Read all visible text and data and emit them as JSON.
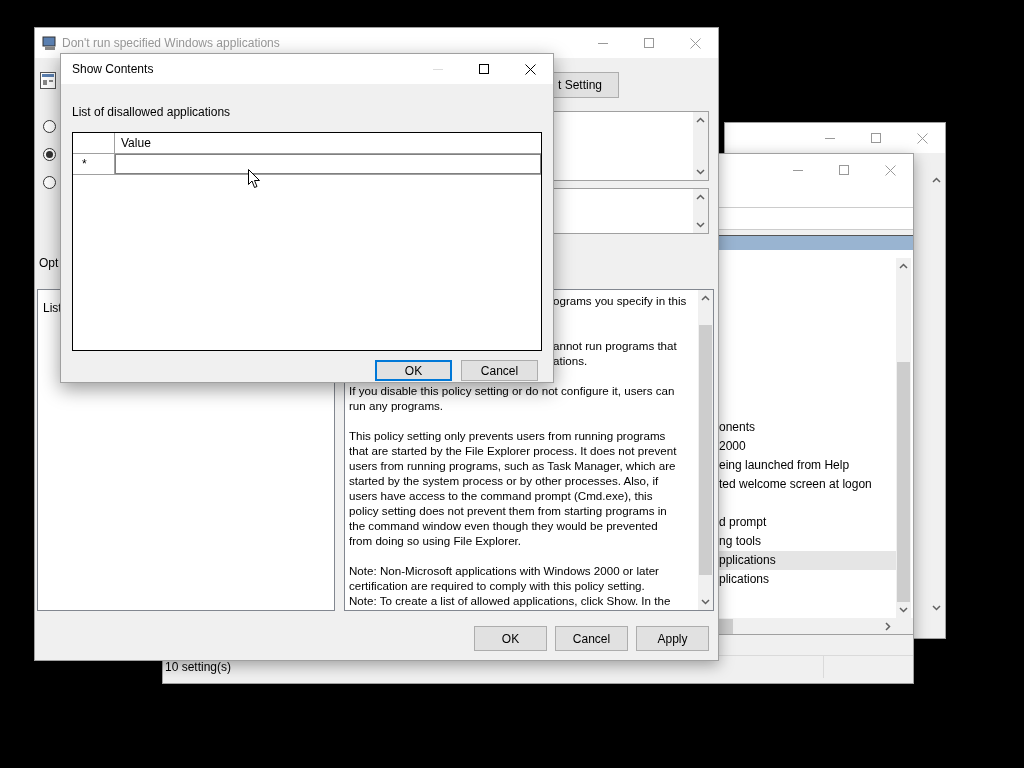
{
  "editor_window": {
    "list_items": [
      {
        "kind": "text",
        "label": "onents",
        "selected": false
      },
      {
        "kind": "text",
        "label": "2000",
        "selected": false
      },
      {
        "kind": "text",
        "label": "eing launched from Help",
        "selected": false
      },
      {
        "kind": "text",
        "label": "ted welcome screen at logon",
        "selected": false
      },
      {
        "kind": "blank"
      },
      {
        "kind": "text",
        "label": "d prompt",
        "selected": false
      },
      {
        "kind": "text",
        "label": "ng tools",
        "selected": false
      },
      {
        "kind": "text",
        "label": "pplications",
        "selected": true
      },
      {
        "kind": "text",
        "label": "plications",
        "selected": false
      }
    ],
    "status_bar": "10 setting(s)"
  },
  "policy_window": {
    "title": "Don't run specified Windows applications",
    "next_button": "t Setting",
    "radios": [
      {
        "selected": false
      },
      {
        "selected": true
      },
      {
        "selected": false
      }
    ],
    "options_label": "Opt",
    "options_panel_text": "List",
    "help_lines": [
      {
        "kind": "clipped",
        "text": "ograms you specify in this"
      },
      {
        "kind": "blank"
      },
      {
        "kind": "blank"
      },
      {
        "kind": "clipped",
        "text": "annot run programs that"
      },
      {
        "kind": "clipped",
        "text": "ations."
      },
      {
        "kind": "blank"
      },
      {
        "kind": "full",
        "text": "If you disable this policy setting or do not configure it, users can"
      },
      {
        "kind": "full",
        "text": "run any programs."
      },
      {
        "kind": "blank"
      },
      {
        "kind": "full",
        "text": "This policy setting only prevents users from running programs"
      },
      {
        "kind": "full",
        "text": "that are started by the File Explorer process. It does not prevent"
      },
      {
        "kind": "full",
        "text": "users from running programs, such as Task Manager, which are"
      },
      {
        "kind": "full",
        "text": "started by the system process or by other processes.  Also, if"
      },
      {
        "kind": "full",
        "text": "users have access to the command prompt (Cmd.exe), this"
      },
      {
        "kind": "full",
        "text": "policy setting does not prevent them from starting programs in"
      },
      {
        "kind": "full",
        "text": "the command window even though they would be prevented"
      },
      {
        "kind": "full",
        "text": "from doing so using File Explorer."
      },
      {
        "kind": "blank"
      },
      {
        "kind": "full",
        "text": "Note: Non-Microsoft applications with Windows 2000 or later"
      },
      {
        "kind": "full",
        "text": "certification are required to comply with this policy setting."
      },
      {
        "kind": "full",
        "text": "Note: To create a list of allowed applications, click Show.  In the"
      }
    ],
    "buttons": [
      "OK",
      "Cancel",
      "Apply"
    ]
  },
  "show_contents": {
    "title": "Show Contents",
    "label": "List of disallowed applications",
    "columns": [
      "Value"
    ],
    "rows": [
      {
        "marker": "*"
      }
    ],
    "buttons": [
      {
        "label": "OK",
        "default": true
      },
      {
        "label": "Cancel",
        "default": false
      }
    ]
  }
}
